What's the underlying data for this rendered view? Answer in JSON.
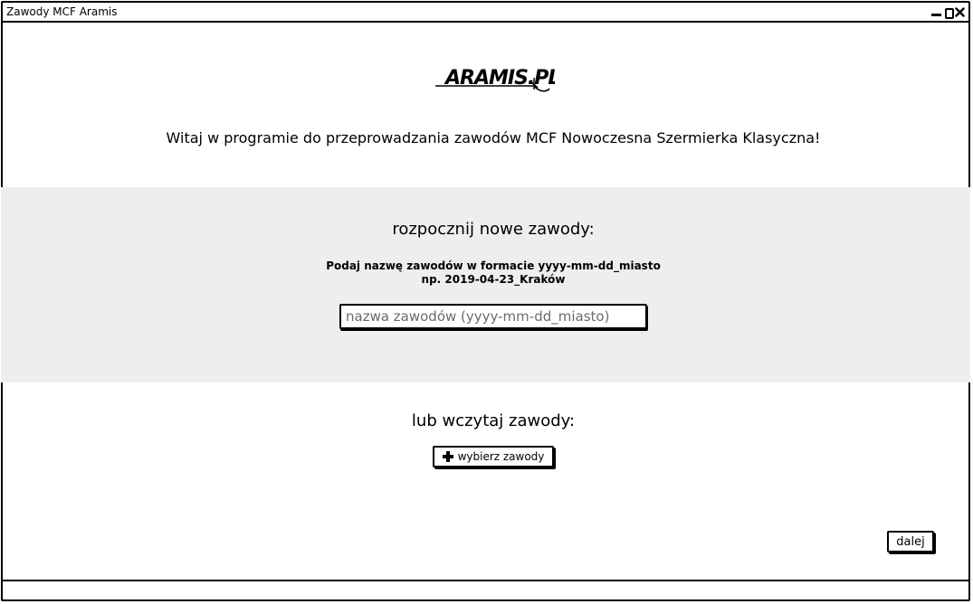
{
  "window": {
    "title": "Zawody MCF Aramis"
  },
  "logo": {
    "text": "ARAMIS.PL"
  },
  "welcome_text": "Witaj w programie do przeprowadzania zawodów MCF Nowoczesna Szermierka Klasyczna!",
  "new_competition": {
    "title": "rozpocznij nowe zawody:",
    "instruction_line1": "Podaj nazwę zawodów w formacie yyyy-mm-dd_miasto",
    "instruction_line2": "np. 2019-04-23_Kraków",
    "input_placeholder": "nazwa zawodów (yyyy-mm-dd_miasto)",
    "input_value": ""
  },
  "load_competition": {
    "title": "lub wczytaj zawody:",
    "choose_button_label": "wybierz zawody"
  },
  "next_button_label": "dalej",
  "colors": {
    "band_background": "#eeeeee",
    "border": "#000000",
    "placeholder": "#6b6b6b"
  }
}
